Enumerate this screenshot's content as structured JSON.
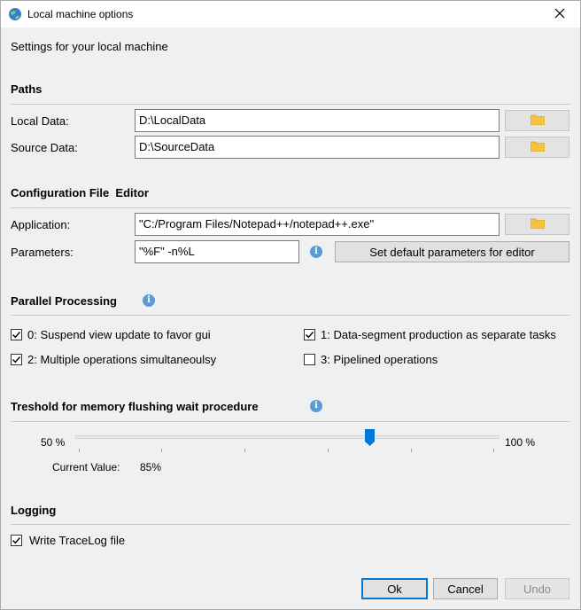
{
  "window": {
    "title": "Local machine options",
    "subtitle": "Settings for your local machine"
  },
  "paths": {
    "header": "Paths",
    "local_data_label": "Local Data:",
    "local_data_value": "D:\\LocalData",
    "source_data_label": "Source Data:",
    "source_data_value": "D:\\SourceData"
  },
  "editor": {
    "header": "Configuration File  Editor",
    "application_label": "Application:",
    "application_value": "\"C:/Program Files/Notepad++/notepad++.exe\"",
    "parameters_label": "Parameters:",
    "parameters_value": "\"%F\" -n%L",
    "default_button": "Set default parameters for editor"
  },
  "parallel": {
    "header": "Parallel Processing",
    "options": [
      {
        "label": "0: Suspend view update to favor gui",
        "checked": true
      },
      {
        "label": "1: Data-segment production as separate tasks",
        "checked": true
      },
      {
        "label": "2: Multiple operations simultaneoulsy",
        "checked": true
      },
      {
        "label": "3: Pipelined operations",
        "checked": false
      }
    ]
  },
  "threshold": {
    "header": "Treshold for memory flushing wait procedure",
    "min_label": "50 %",
    "max_label": "100 %",
    "current_label": "Current Value:",
    "current_value": "85%",
    "value_percent": 85
  },
  "logging": {
    "header": "Logging",
    "tracelog_label": "Write TraceLog file",
    "tracelog_checked": true
  },
  "buttons": {
    "ok": "Ok",
    "cancel": "Cancel",
    "undo": "Undo"
  },
  "colors": {
    "accent": "#0078d7",
    "info": "#5b9bd5",
    "folder": "#f5c342"
  },
  "icons": [
    "app-globe-icon",
    "close-icon",
    "folder-icon",
    "info-icon",
    "checkmark-icon",
    "slider-thumb"
  ]
}
